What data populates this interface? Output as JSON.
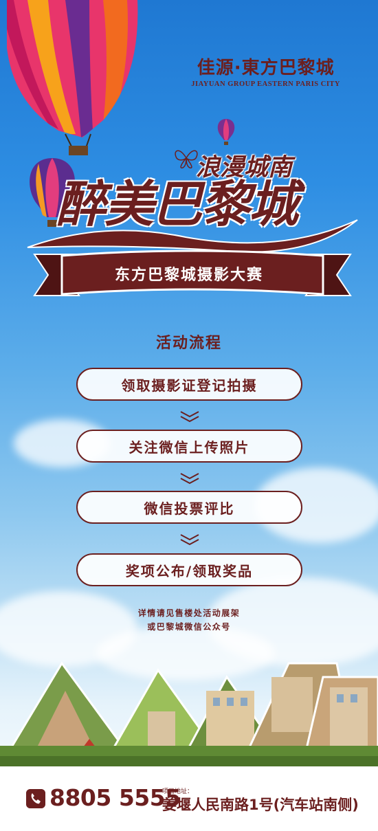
{
  "brand": {
    "name_cn": "佳源·東方巴黎城",
    "name_en": "JIAYUAN GROUP EASTERN PARIS CITY"
  },
  "headline": {
    "subtitle": "浪漫城南",
    "title": "醉美巴黎城"
  },
  "banner": {
    "text": "东方巴黎城摄影大赛"
  },
  "process": {
    "title": "活动流程",
    "steps": [
      "领取摄影证登记拍摄",
      "关注微信上传照片",
      "微信投票评比",
      "奖项公布/领取奖品"
    ]
  },
  "note": {
    "line1": "详情请见售楼处活动展架",
    "line2": "或巴黎城微信公众号"
  },
  "contact": {
    "phone": "8805 5555",
    "address_label": "项目地址：",
    "address": "姜堰人民南路1号(汽车站南侧)"
  },
  "colors": {
    "brand": "#6b1f1f",
    "sky_top": "#1f78d2",
    "sky_bottom": "#e6f3fb"
  },
  "icons": [
    "hot-air-balloon-icon",
    "butterfly-icon",
    "phone-icon",
    "chevron-down-icon"
  ]
}
